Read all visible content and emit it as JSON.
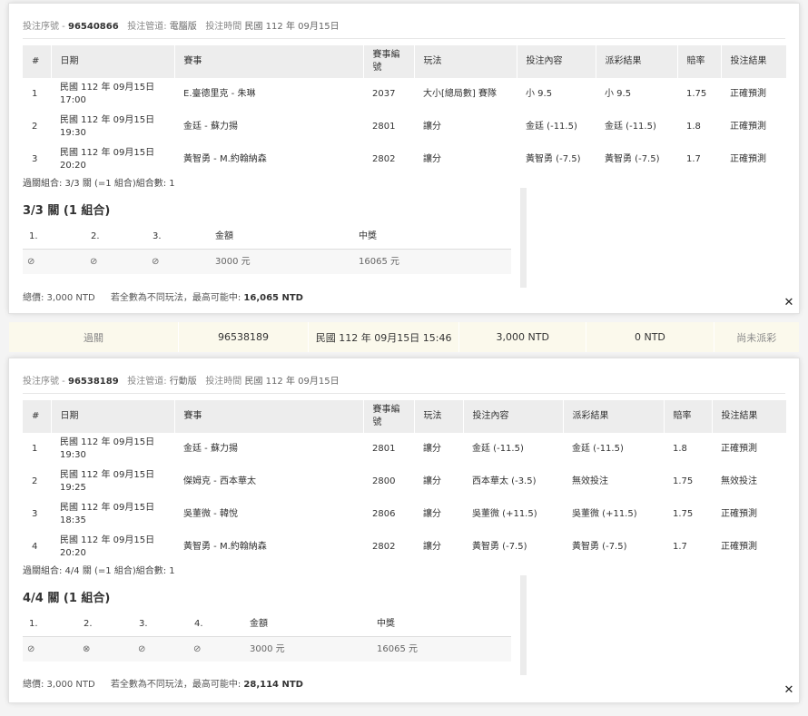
{
  "bet1": {
    "serial_label": "投注序號 -",
    "serial": "96540866",
    "channel_label": "投注管道:",
    "channel": "電腦版",
    "time_label": "投注時間",
    "time": "民國 112 年 09月15日",
    "columns": [
      "#",
      "日期",
      "賽事",
      "賽事編號",
      "玩法",
      "投注內容",
      "派彩結果",
      "賠率",
      "投注結果"
    ],
    "rows": [
      {
        "no": "1",
        "date": "民國 112 年 09月15日",
        "time": "17:00",
        "event": "E.臺德里克 - 朱琳",
        "code": "2037",
        "play": "大小[總局數] 賽隊",
        "bet": "小 9.5",
        "result": "小 9.5",
        "odds": "1.75",
        "outcome": "正確預測"
      },
      {
        "no": "2",
        "date": "民國 112 年 09月15日",
        "time": "19:30",
        "event": "金廷 - 蘇力揚",
        "code": "2801",
        "play": "讓分",
        "bet": "金廷 (-11.5)",
        "result": "金廷 (-11.5)",
        "odds": "1.8",
        "outcome": "正確預測"
      },
      {
        "no": "3",
        "date": "民國 112 年 09月15日",
        "time": "20:20",
        "event": "黃智勇 - M.約翰納森",
        "code": "2802",
        "play": "讓分",
        "bet": "黃智勇 (-7.5)",
        "result": "黃智勇 (-7.5)",
        "odds": "1.7",
        "outcome": "正確預測"
      }
    ],
    "summary": "過關組合: 3/3 關 (=1 組合)組合數: 1",
    "combo_title": "3/3 關 (1 組合)",
    "combo_headers": [
      "1.",
      "2.",
      "3.",
      "金額",
      "中獎"
    ],
    "combo_row": {
      "amount": "3000 元",
      "prize": "16065 元"
    },
    "combo_marks": [
      "ok",
      "ok",
      "ok"
    ],
    "total_label": "總價: 3,000 NTD",
    "max_label": "若全數為不同玩法，最高可能中:",
    "max_value": "16,065 NTD"
  },
  "bar": {
    "type": "過關",
    "serial": "96538189",
    "datetime": "民國 112 年 09月15日 15:46",
    "amount": "3,000 NTD",
    "payout": "0 NTD",
    "status": "尚未派彩"
  },
  "bet2": {
    "serial_label": "投注序號 -",
    "serial": "96538189",
    "channel_label": "投注管道:",
    "channel": "行動版",
    "time_label": "投注時間",
    "time": "民國 112 年 09月15日",
    "columns": [
      "#",
      "日期",
      "賽事",
      "賽事編號",
      "玩法",
      "投注內容",
      "派彩結果",
      "賠率",
      "投注結果"
    ],
    "rows": [
      {
        "no": "1",
        "date": "民國 112 年 09月15日",
        "time": "19:30",
        "event": "金廷 - 蘇力揚",
        "code": "2801",
        "play": "讓分",
        "bet": "金廷 (-11.5)",
        "result": "金廷 (-11.5)",
        "odds": "1.8",
        "outcome": "正確預測"
      },
      {
        "no": "2",
        "date": "民國 112 年 09月15日",
        "time": "19:25",
        "event": "傑姆克 - 西本華太",
        "code": "2800",
        "play": "讓分",
        "bet": "西本華太 (-3.5)",
        "result": "無效投注",
        "odds": "1.75",
        "outcome": "無效投注"
      },
      {
        "no": "3",
        "date": "民國 112 年 09月15日",
        "time": "18:35",
        "event": "吳董微 - 韓悅",
        "code": "2806",
        "play": "讓分",
        "bet": "吳董微 (+11.5)",
        "result": "吳董微 (+11.5)",
        "odds": "1.75",
        "outcome": "正確預測"
      },
      {
        "no": "4",
        "date": "民國 112 年 09月15日",
        "time": "20:20",
        "event": "黃智勇 - M.約翰納森",
        "code": "2802",
        "play": "讓分",
        "bet": "黃智勇 (-7.5)",
        "result": "黃智勇 (-7.5)",
        "odds": "1.7",
        "outcome": "正確預測"
      }
    ],
    "summary": "過關組合: 4/4 關 (=1 組合)組合數: 1",
    "combo_title": "4/4 關 (1 組合)",
    "combo_headers": [
      "1.",
      "2.",
      "3.",
      "4.",
      "金額",
      "中獎"
    ],
    "combo_row": {
      "amount": "3000 元",
      "prize": "16065 元"
    },
    "combo_marks": [
      "ok",
      "void",
      "ok",
      "ok"
    ],
    "total_label": "總價: 3,000 NTD",
    "max_label": "若全數為不同玩法，最高可能中:",
    "max_value": "28,114 NTD"
  },
  "icons": {
    "ok": "✓-circle-icon",
    "void": "x-circle-icon",
    "close": "close-icon"
  },
  "colors": {
    "ok": "#3cb15c",
    "bar": "#fbf9ec"
  }
}
